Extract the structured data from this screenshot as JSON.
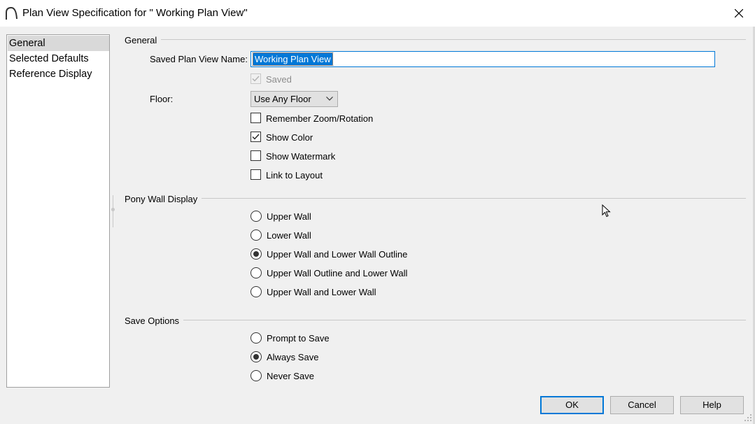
{
  "window": {
    "title": "Plan View Specification for \" Working Plan View\"",
    "icon": "chief-architect-arc-icon"
  },
  "nav": {
    "items": [
      {
        "label": "General",
        "selected": true
      },
      {
        "label": "Selected Defaults",
        "selected": false
      },
      {
        "label": "Reference Display",
        "selected": false
      }
    ]
  },
  "general": {
    "header": "General",
    "name_label": "Saved Plan View Name:",
    "name_value": "Working Plan View",
    "saved_label": "Saved",
    "saved_checked": true,
    "floor_label": "Floor:",
    "floor_value": "Use Any Floor",
    "checkboxes": [
      {
        "label": "Remember Zoom/Rotation",
        "checked": false
      },
      {
        "label": "Show Color",
        "checked": true
      },
      {
        "label": "Show Watermark",
        "checked": false
      },
      {
        "label": "Link to Layout",
        "checked": false
      }
    ]
  },
  "pony": {
    "header": "Pony Wall Display",
    "options": [
      {
        "label": "Upper Wall",
        "checked": false
      },
      {
        "label": "Lower Wall",
        "checked": false
      },
      {
        "label": "Upper Wall and Lower Wall Outline",
        "checked": true
      },
      {
        "label": "Upper Wall Outline and Lower Wall",
        "checked": false
      },
      {
        "label": "Upper Wall and Lower Wall",
        "checked": false
      }
    ]
  },
  "save": {
    "header": "Save Options",
    "options": [
      {
        "label": "Prompt to Save",
        "checked": false
      },
      {
        "label": "Always Save",
        "checked": true
      },
      {
        "label": "Never Save",
        "checked": false
      }
    ]
  },
  "buttons": {
    "ok": "OK",
    "cancel": "Cancel",
    "help": "Help"
  },
  "colors": {
    "accent": "#0078d7",
    "background": "#f0f0f0"
  }
}
